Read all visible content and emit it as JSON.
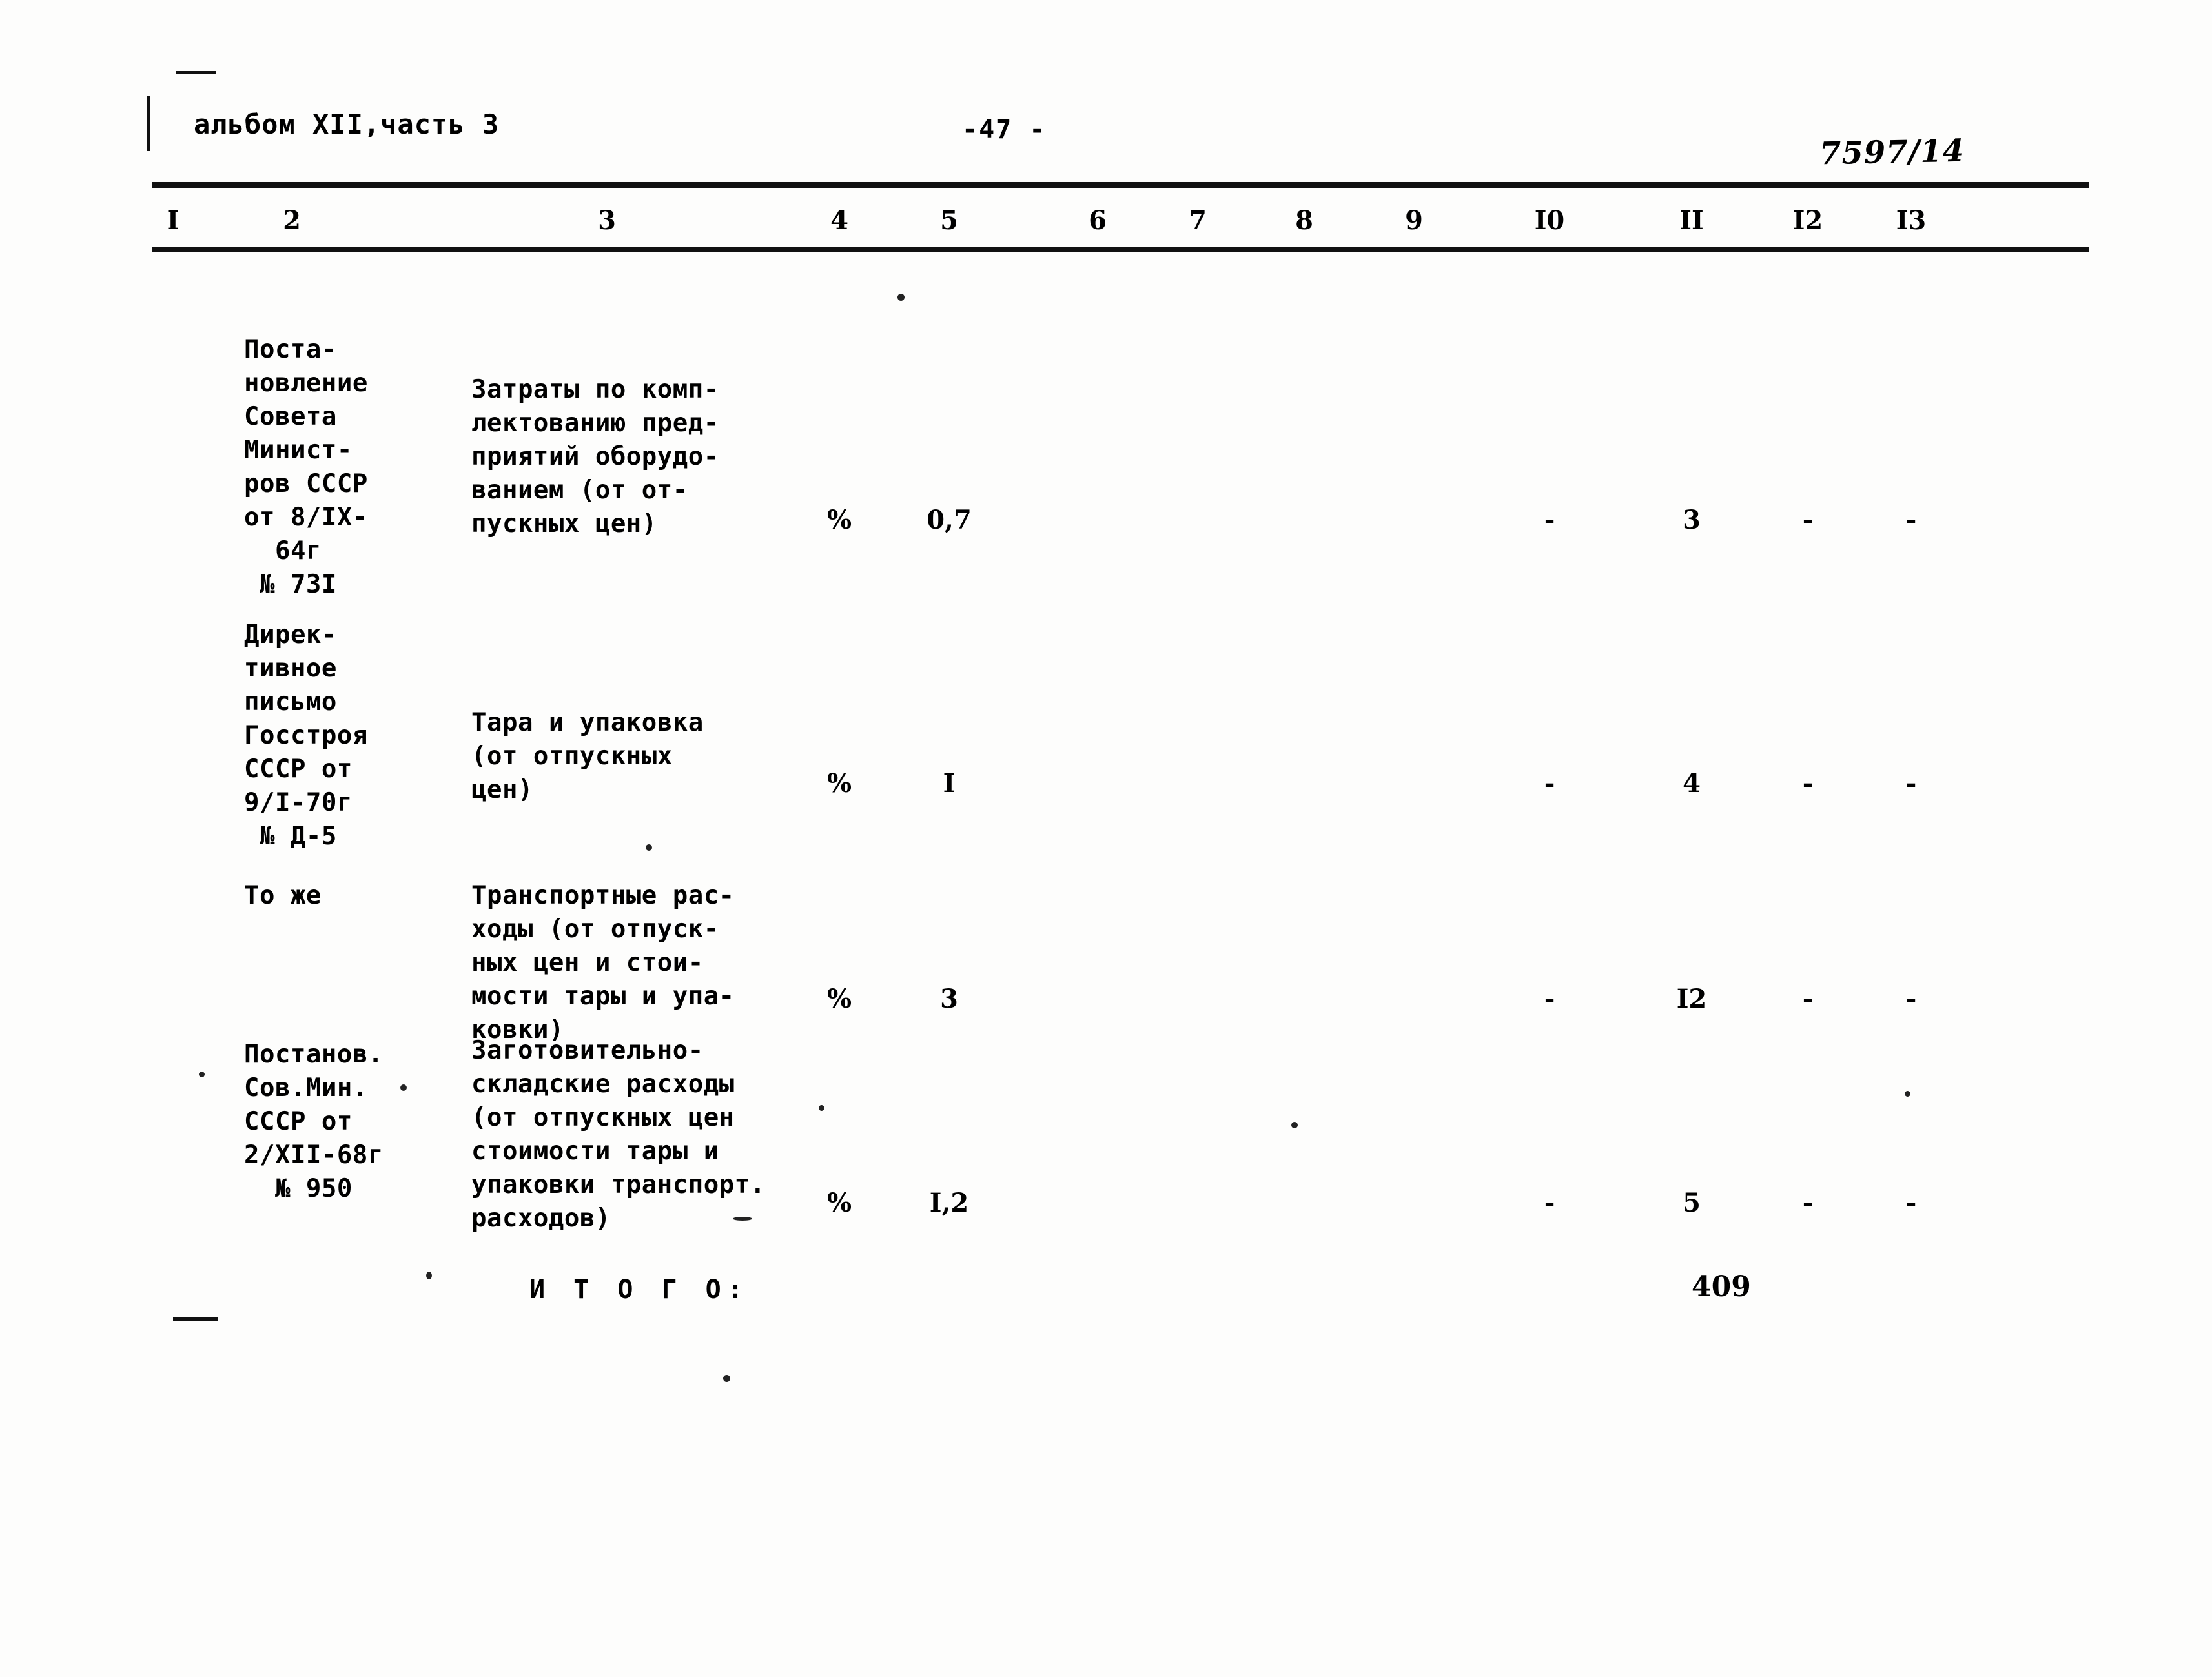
{
  "header": {
    "album": "альбом XII,часть 3",
    "page_number": "-47 -",
    "stamp": "7597/14"
  },
  "table": {
    "column_numbers": [
      "I",
      "2",
      "3",
      "4",
      "5",
      "6",
      "7",
      "8",
      "9",
      "I0",
      "II",
      "I2",
      "I3"
    ],
    "rows": [
      {
        "col2": "Поста-\nновление\nСовета\nМинист-\nров СССР\nот 8/IX-\n  64г\n № 73I",
        "col3": "Затраты по комп-\nлектованию пред-\nприятий оборудо-\nванием (от от-\nпускных цен)",
        "col4": "%",
        "col5": "0,7",
        "col6": "",
        "col7": "",
        "col8": "",
        "col9": "",
        "col10": "-",
        "col11": "3",
        "col12": "-",
        "col13": "-"
      },
      {
        "col2": "Дирек-\nтивное\nписьмо\nГосстроя\nСССР от\n9/I-70г\n № Д-5",
        "col3": "Тара и упаковка\n(от отпускных\nцен)",
        "col4": "%",
        "col5": "I",
        "col6": "",
        "col7": "",
        "col8": "",
        "col9": "",
        "col10": "-",
        "col11": "4",
        "col12": "-",
        "col13": "-"
      },
      {
        "col2": "То же",
        "col3": "Транспортные рас-\nходы (от отпуск-\nных цен и стои-\nмости тары и упа-\nковки)",
        "col4": "%",
        "col5": "3",
        "col6": "",
        "col7": "",
        "col8": "",
        "col9": "",
        "col10": "-",
        "col11": "I2",
        "col12": "-",
        "col13": "-"
      },
      {
        "col2": "Постанов.\nСов.Мин.\nСССР от\n2/ХII-68г\n  № 950",
        "col3": "Заготовительно-\nскладские расходы\n(от отпускных цен\nстоимости тары и\nупаковки транспорт.\nрасходов)",
        "col4": "%",
        "col5": "I,2",
        "col6": "",
        "col7": "",
        "col8": "",
        "col9": "",
        "col10": "-",
        "col11": "5",
        "col12": "-",
        "col13": "-"
      }
    ],
    "total": {
      "label": "И Т О Г О:",
      "value": "409"
    }
  }
}
